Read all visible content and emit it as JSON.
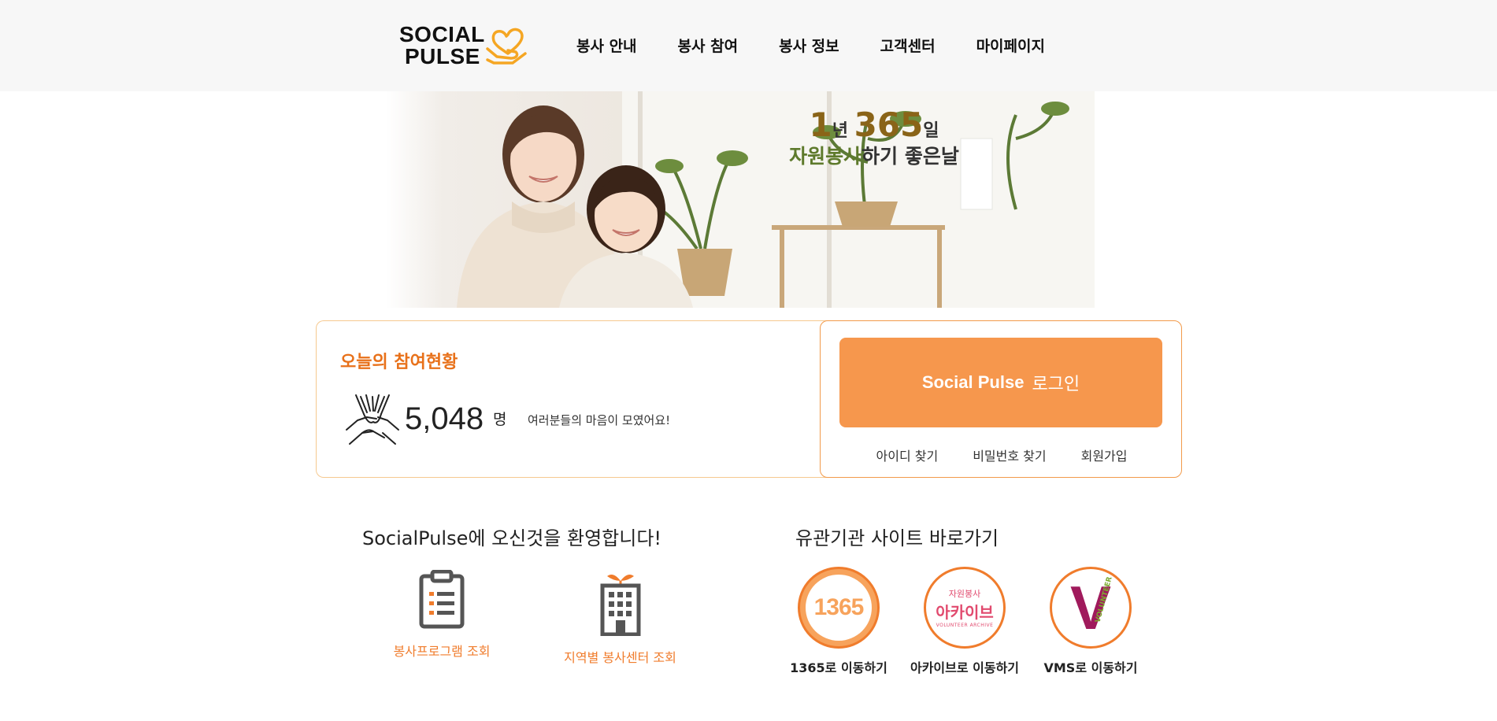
{
  "header": {
    "logo": {
      "line1": "SOCIAL",
      "line2": "PULSE",
      "icon": "heart-hand-icon"
    },
    "nav": [
      {
        "label": "봉사 안내"
      },
      {
        "label": "봉사 참여"
      },
      {
        "label": "봉사 정보"
      },
      {
        "label": "고객센터"
      },
      {
        "label": "마이페이지"
      }
    ]
  },
  "hero": {
    "num1": "1",
    "unit1": "년 ",
    "num2": "365",
    "unit2": "일",
    "highlight": "자원봉사",
    "rest": "하기 좋은날"
  },
  "stats": {
    "title": "오늘의 참여현황",
    "count": "5,048",
    "unit": "명",
    "message": "여러분들의 마음이 모였어요!",
    "icon": "joined-hands-icon"
  },
  "login": {
    "brand": "Social Pulse",
    "label": "로그인",
    "links": [
      "아이디 찾기",
      "비밀번호 찾기",
      "회원가입"
    ]
  },
  "welcome": {
    "title": "SocialPulse에 오신것을 환영합니다!",
    "items": [
      {
        "label": "봉사프로그램 조회",
        "icon": "clipboard-icon"
      },
      {
        "label": "지역별 봉사센터 조회",
        "icon": "building-icon"
      }
    ]
  },
  "related": {
    "title": "유관기관 사이트 바로가기",
    "sites": [
      {
        "logo": "1365",
        "label": "1365로 이동하기"
      },
      {
        "logo_top": "자원봉사",
        "logo_main": "아카이브",
        "logo_sub": "VOLUNTEER ARCHIVE",
        "label": "아카이브로 이동하기"
      },
      {
        "logo_v": "V",
        "logo_text": "VOLUNTEER",
        "label": "VMS로 이동하기"
      }
    ]
  },
  "colors": {
    "accent": "#f6974d",
    "accent_dark": "#e8711a",
    "header_bg": "#f7f7f7"
  }
}
